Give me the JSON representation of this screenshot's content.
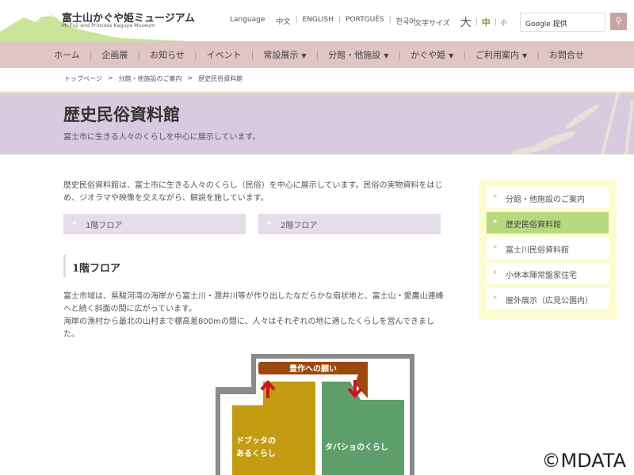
{
  "header": {
    "logo_jp": "富士山かぐや姫ミュージアム",
    "logo_en": "Mt.Fuji and Princess Kaguya Museum",
    "language_label": "Language",
    "languages": [
      "中文",
      "ENGLISH",
      "PORTGUÊS",
      "한국어"
    ],
    "font_size_label": "文字サイズ",
    "font_sizes": [
      "大",
      "中",
      "小"
    ],
    "search_placeholder": "Google 提供",
    "search_icon": "magnifier"
  },
  "nav": [
    {
      "label": "ホーム"
    },
    {
      "label": "企画展"
    },
    {
      "label": "お知らせ"
    },
    {
      "label": "イベント"
    },
    {
      "label": "常設展示",
      "dropdown": true
    },
    {
      "label": "分館・他施設",
      "dropdown": true
    },
    {
      "label": "かぐや姫",
      "dropdown": true
    },
    {
      "label": "ご利用案内",
      "dropdown": true
    },
    {
      "label": "お問合せ"
    }
  ],
  "breadcrumb": [
    "トップページ",
    "分館・他施設のご案内",
    "歴史民俗資料館"
  ],
  "banner": {
    "title": "歴史民俗資料館",
    "subtitle": "富士市に生きる人々のくらしを中心に展示しています。"
  },
  "intro": "歴史民俗資料館は、富士市に生きる人々のくらし（民俗）を中心に展示しています。民俗の実物資料をはじめ、ジオラマや映像を交えながら、解説を施しています。",
  "floor_buttons": [
    "1階フロア",
    "2階フロア"
  ],
  "section": {
    "heading": "1階フロア",
    "para1": "富士市域は、県駿河湾の海岸から富士川・潤井川等が作り出したなだらかな扇状地と、富士山・愛鷹山連峰へと続く斜面の間に広がっています。",
    "para2": "海岸の漁村から最北の山村まで標高差800mの間に、人々はそれぞれの地に適したくらしを営んできました。"
  },
  "map": {
    "top": "豊作への願い",
    "left": "ドブッタのあるくらし",
    "left_l1": "ドブッタの",
    "left_l2": "あるくらし",
    "right": "タバショのくらし",
    "colors": {
      "top": "#9a4a0c",
      "left": "#c39c12",
      "right": "#5e9e6a",
      "arrow": "#c8141c"
    }
  },
  "sidebar": {
    "items": [
      "分館・他施設のご案内",
      "歴史民俗資料館",
      "富士川民俗資料館",
      "小休本陣常盤家住宅",
      "屋外展示（広見公園内）"
    ],
    "active": 1
  },
  "watermark": "©MDATA"
}
